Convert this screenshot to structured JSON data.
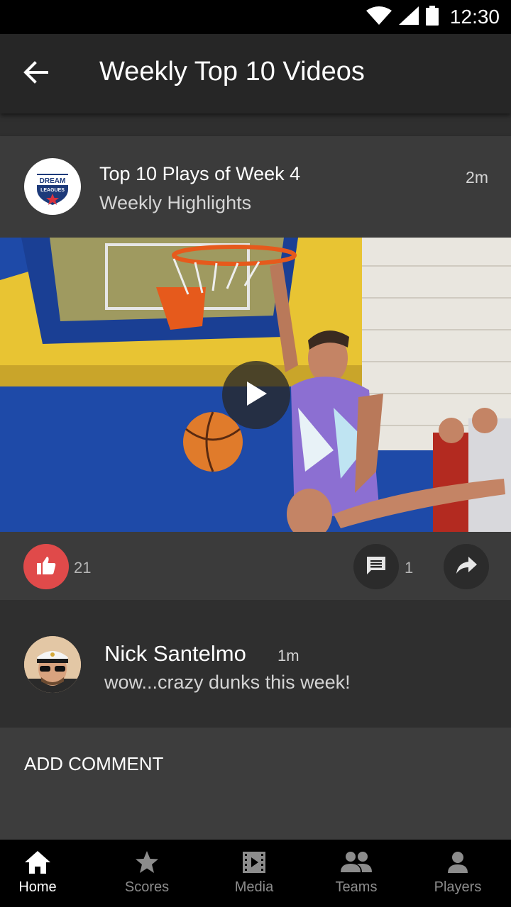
{
  "status_bar": {
    "time": "12:30",
    "icons": [
      "wifi-icon",
      "signal-icon",
      "battery-icon"
    ]
  },
  "app_bar": {
    "back_icon": "arrow-left-icon",
    "title": "Weekly Top 10 Videos"
  },
  "post": {
    "logo_text": "DREAM",
    "logo_subtext": "LEAGUES",
    "title": "Top 10 Plays of Week 4",
    "subtitle": "Weekly Highlights",
    "time": "2m",
    "play_icon": "play-icon",
    "likes": "21",
    "comments": "1",
    "colors": {
      "like_accent": "#e04a4a"
    }
  },
  "comment": {
    "name": "Nick Santelmo",
    "time": "1m",
    "text": "wow...crazy dunks this week!"
  },
  "add_comment": {
    "label": "ADD COMMENT"
  },
  "bottom_nav": {
    "items": [
      {
        "label": "Home",
        "icon": "home-icon",
        "active": true
      },
      {
        "label": "Scores",
        "icon": "star-icon",
        "active": false
      },
      {
        "label": "Media",
        "icon": "film-icon",
        "active": false
      },
      {
        "label": "Teams",
        "icon": "people-icon",
        "active": false
      },
      {
        "label": "Players",
        "icon": "person-icon",
        "active": false
      }
    ]
  }
}
